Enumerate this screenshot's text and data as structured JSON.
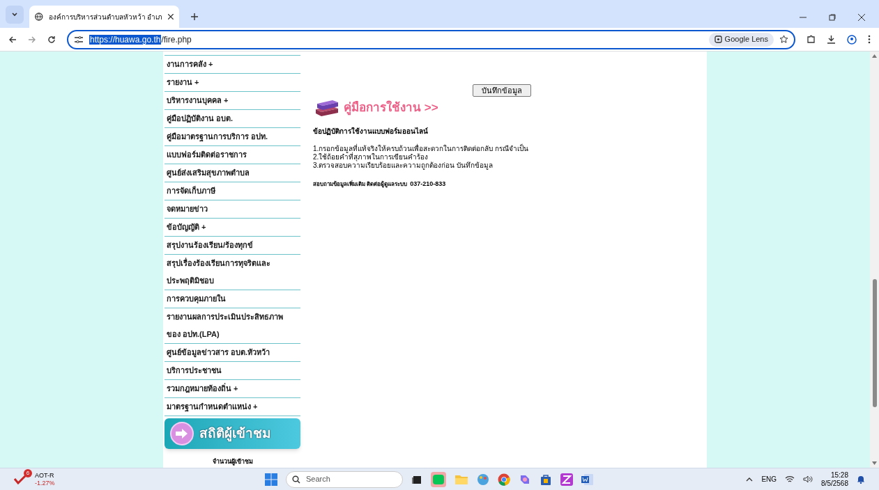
{
  "browser": {
    "tabs": [
      {
        "title": "องค์การบริหารส่วนตำบลหัวหว้า อำเภ",
        "selected": true
      }
    ],
    "url_host": "https://huawa.go.th",
    "url_path": "/fire.php",
    "lens_label": "Google Lens"
  },
  "sidebar": {
    "items": [
      {
        "lines": [
          "งานการคลัง +"
        ]
      },
      {
        "lines": [
          "รายงาน +"
        ]
      },
      {
        "lines": [
          "บริหารงานบุคคล +"
        ]
      },
      {
        "lines": [
          "คู่มือปฏิบัติงาน อบต."
        ]
      },
      {
        "lines": [
          "คู่มือมาตรฐานการบริการ อปท."
        ]
      },
      {
        "lines": [
          "แบบฟอร์มติดต่อราชการ"
        ]
      },
      {
        "lines": [
          "ศูนย์ส่งเสริมสุขภาพตำบล"
        ]
      },
      {
        "lines": [
          "การจัดเก็บภาษี"
        ]
      },
      {
        "lines": [
          "จดหมายข่าว"
        ]
      },
      {
        "lines": [
          "ข้อบัญญัติ +"
        ]
      },
      {
        "lines": [
          "สรุปงานร้องเรียน/ร้องทุกข์"
        ]
      },
      {
        "lines": [
          "สรุปเรื่องร้องเรียนการทุจริตและ",
          "ประพฤติมิชอบ"
        ]
      },
      {
        "lines": [
          "การควบคุมภายใน"
        ]
      },
      {
        "lines": [
          "รายงานผลการประเมินประสิทธภาพ",
          "ของ อปท.(LPA)"
        ]
      },
      {
        "lines": [
          "ศูนย์ข้อมูลข่าวสาร อบต.หัวหว้า"
        ]
      },
      {
        "lines": [
          "บริการประชาชน"
        ]
      },
      {
        "lines": [
          "รวมกฎหมายท้องถิ่น +"
        ]
      },
      {
        "lines": [
          "มาตรฐานกำหนดตำแหน่ง +"
        ]
      }
    ],
    "stats_banner": "สถิติผู้เข้าชม",
    "visitors_label": "จำนวนผู้เข้าชม"
  },
  "main": {
    "save_button": "บันทึกข้อมูล",
    "manual_link": "คู่มือการใช้งาน >>",
    "rules_title": "ข้อปฏิบัติการใช้งานแบบฟอร์มออนไลน์",
    "rules": [
      "1.กรอกข้อมูลที่แท้จริงให้ครบถ้วนเพื่อสะดวกในการติดต่อกลับ กรณีจำเป็น",
      "2.ใช้ถ้อยคำที่สุภาพในการเขียนคำร้อง",
      "3.ตรวจสอบความเรียบร้อยและความถูกต้องก่อน บันทึกข้อมูล"
    ],
    "contact_label": "สอบถามข้อมูลเพิ่มเติม ติดต่อผู้ดูแลระบบ",
    "contact_phone": "037-210-833"
  },
  "taskbar": {
    "stock_name": "AOT-R",
    "stock_change": "-1.27%",
    "stock_badge": "6",
    "search_placeholder": "Search",
    "language": "ENG",
    "time": "15:28",
    "date": "8/5/2568"
  }
}
